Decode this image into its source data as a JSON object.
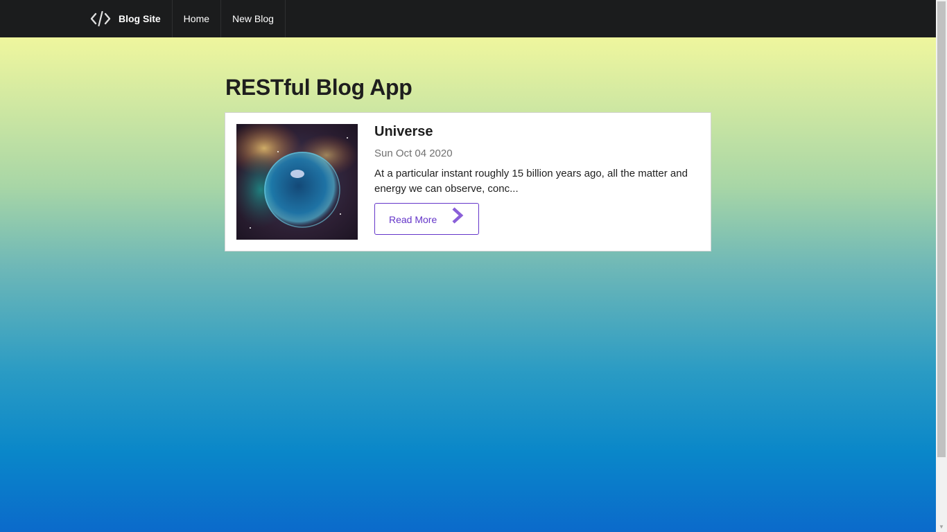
{
  "navbar": {
    "brand_label": "Blog Site",
    "brand_icon": "code-icon",
    "items": [
      {
        "label": "Home"
      },
      {
        "label": "New Blog"
      }
    ]
  },
  "page": {
    "title": "RESTful Blog App"
  },
  "posts": [
    {
      "title": "Universe",
      "date": "Sun Oct 04 2020",
      "excerpt": "At a particular instant roughly 15 billion years ago, all the matter and energy we can observe, conc...",
      "read_more_label": "Read More",
      "image_alt": "Bubble Nebula image"
    }
  ],
  "colors": {
    "navbar_bg": "#1b1c1d",
    "accent": "#6435c9",
    "gradient_top": "#fdfc98",
    "gradient_bottom": "#0b6acb"
  }
}
